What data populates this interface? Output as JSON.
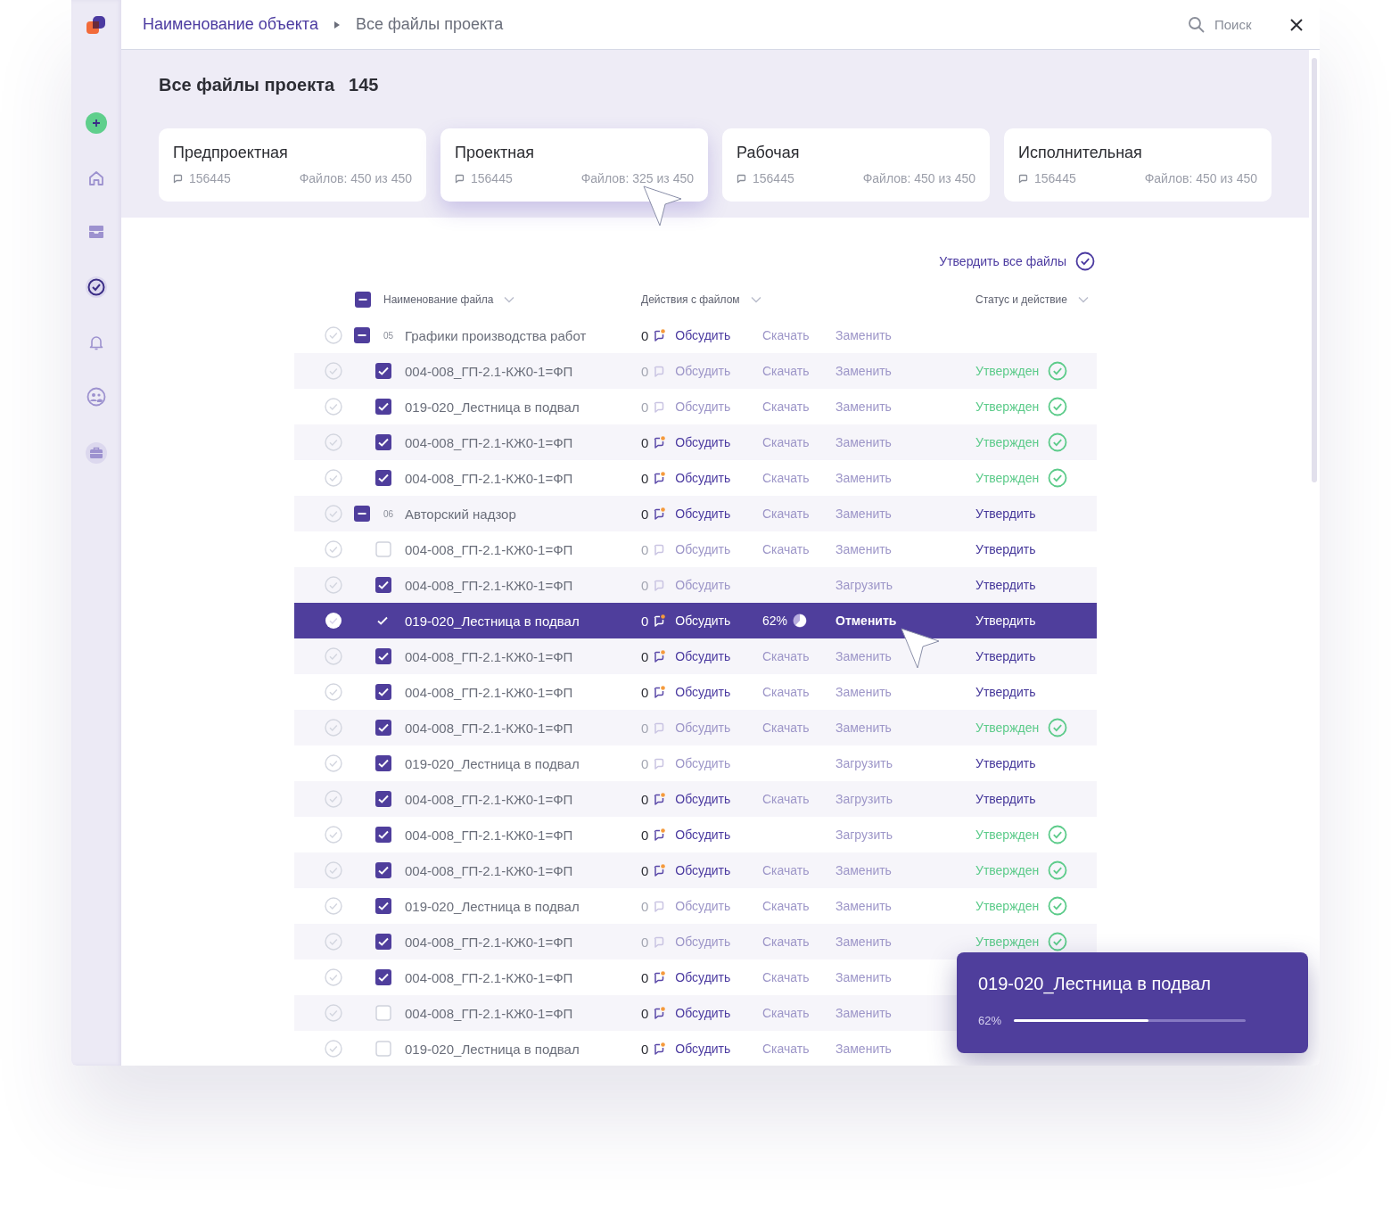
{
  "sidebar": {
    "items": [
      {
        "kind": "add",
        "selected": false
      },
      {
        "kind": "home",
        "selected": false
      },
      {
        "kind": "inbox",
        "selected": false
      },
      {
        "kind": "tasks",
        "selected": true
      },
      {
        "kind": "bell",
        "selected": false
      },
      {
        "kind": "people",
        "selected": false
      },
      {
        "kind": "briefcase",
        "selected": false
      }
    ]
  },
  "breadcrumb": [
    {
      "label": "Наименование объекта",
      "kind": "link"
    },
    {
      "label": "Все файлы проекта",
      "kind": "current"
    }
  ],
  "search": {
    "placeholder": "Поиск"
  },
  "page": {
    "title": "Все файлы проекта",
    "count": "145"
  },
  "stages": [
    {
      "title": "Предпроектная",
      "comments": "156445",
      "files": "Файлов: 450 из 450",
      "selected": false
    },
    {
      "title": "Проектная",
      "comments": "156445",
      "files": "Файлов: 325 из 450",
      "selected": true
    },
    {
      "title": "Рабочая",
      "comments": "156445",
      "files": "Файлов: 450 из 450",
      "selected": false
    },
    {
      "title": "Исполнительная",
      "comments": "156445",
      "files": "Файлов: 450 из 450",
      "selected": false
    }
  ],
  "approve_all": "Утвердить все файлы",
  "table": {
    "select_all": {
      "partial": true
    },
    "columns": [
      {
        "label": "Наименование файла"
      },
      {
        "label": "Действия с файлом"
      },
      {
        "label": "Статус и действие"
      }
    ],
    "groups": [
      {
        "number": "05",
        "name": "Графики производства работ",
        "partial": true,
        "comments": {
          "count": "0",
          "active": true
        },
        "discuss": "Обсудить",
        "download": {
          "kind": "link",
          "label": "Скачать"
        },
        "replace": "Заменить",
        "children": [
          {
            "name": "004-008_ГП-2.1-КЖ0-1=ФП",
            "checked": true,
            "selected": false,
            "comments": {
              "count": "0",
              "active": false
            },
            "discuss": "Обсудить",
            "download": {
              "kind": "link",
              "label": "Скачать"
            },
            "replace": "Заменить",
            "status": {
              "kind": "approved",
              "label": "Утвержден"
            }
          },
          {
            "name": "019-020_Лестница в подвал",
            "checked": true,
            "selected": false,
            "comments": {
              "count": "0",
              "active": false
            },
            "discuss": "Обсудить",
            "download": {
              "kind": "link",
              "label": "Скачать"
            },
            "replace": "Заменить",
            "status": {
              "kind": "approved",
              "label": "Утвержден"
            }
          },
          {
            "name": "004-008_ГП-2.1-КЖ0-1=ФП",
            "checked": true,
            "selected": false,
            "comments": {
              "count": "0",
              "active": true
            },
            "discuss": "Обсудить",
            "download": {
              "kind": "link",
              "label": "Скачать"
            },
            "replace": "Заменить",
            "status": {
              "kind": "approved",
              "label": "Утвержден"
            }
          },
          {
            "name": "004-008_ГП-2.1-КЖ0-1=ФП",
            "checked": true,
            "selected": false,
            "comments": {
              "count": "0",
              "active": true
            },
            "discuss": "Обсудить",
            "download": {
              "kind": "link",
              "label": "Скачать"
            },
            "replace": "Заменить",
            "status": {
              "kind": "approved",
              "label": "Утвержден"
            }
          }
        ]
      },
      {
        "number": "06",
        "name": "Авторский надзор",
        "partial": true,
        "comments": {
          "count": "0",
          "active": true
        },
        "discuss": "Обсудить",
        "download": {
          "kind": "link",
          "label": "Скачать"
        },
        "replace": "Заменить",
        "status": {
          "kind": "approve",
          "label": "Утвердить"
        },
        "children": [
          {
            "name": "004-008_ГП-2.1-КЖ0-1=ФП",
            "checked": false,
            "selected": false,
            "comments": {
              "count": "0",
              "active": false
            },
            "discuss": "Обсудить",
            "download": {
              "kind": "link",
              "label": "Скачать"
            },
            "replace": "Заменить",
            "status": {
              "kind": "approve",
              "label": "Утвердить"
            }
          },
          {
            "name": "004-008_ГП-2.1-КЖ0-1=ФП",
            "checked": true,
            "selected": false,
            "comments": {
              "count": "0",
              "active": false
            },
            "discuss": "Обсудить",
            "replace": "Загрузить",
            "status": {
              "kind": "approve",
              "label": "Утвердить"
            }
          },
          {
            "name": "019-020_Лестница в подвал",
            "checked": true,
            "selected": true,
            "comments": {
              "count": "0",
              "active": true
            },
            "discuss": "Обсудить",
            "download": {
              "kind": "progress",
              "label": "62%",
              "level": 0.62
            },
            "replace": "Отменить",
            "status": {
              "kind": "approve",
              "label": "Утвердить"
            }
          },
          {
            "name": "004-008_ГП-2.1-КЖ0-1=ФП",
            "checked": true,
            "selected": false,
            "comments": {
              "count": "0",
              "active": true
            },
            "discuss": "Обсудить",
            "download": {
              "kind": "link",
              "label": "Скачать"
            },
            "replace": "Заменить",
            "status": {
              "kind": "approve",
              "label": "Утвердить"
            }
          },
          {
            "name": "004-008_ГП-2.1-КЖ0-1=ФП",
            "checked": true,
            "selected": false,
            "comments": {
              "count": "0",
              "active": true
            },
            "discuss": "Обсудить",
            "download": {
              "kind": "link",
              "label": "Скачать"
            },
            "replace": "Заменить",
            "status": {
              "kind": "approve",
              "label": "Утвердить"
            }
          },
          {
            "name": "004-008_ГП-2.1-КЖ0-1=ФП",
            "checked": true,
            "selected": false,
            "comments": {
              "count": "0",
              "active": false
            },
            "discuss": "Обсудить",
            "download": {
              "kind": "link",
              "label": "Скачать"
            },
            "replace": "Заменить",
            "status": {
              "kind": "approved",
              "label": "Утвержден"
            }
          },
          {
            "name": "019-020_Лестница в подвал",
            "checked": true,
            "selected": false,
            "comments": {
              "count": "0",
              "active": false
            },
            "discuss": "Обсудить",
            "replace": "Загрузить",
            "status": {
              "kind": "approve",
              "label": "Утвердить"
            }
          },
          {
            "name": "004-008_ГП-2.1-КЖ0-1=ФП",
            "checked": true,
            "selected": false,
            "comments": {
              "count": "0",
              "active": true
            },
            "discuss": "Обсудить",
            "download": {
              "kind": "link",
              "label": "Скачать"
            },
            "replace": "Загрузить",
            "status": {
              "kind": "approve",
              "label": "Утвердить"
            }
          },
          {
            "name": "004-008_ГП-2.1-КЖ0-1=ФП",
            "checked": true,
            "selected": false,
            "comments": {
              "count": "0",
              "active": true
            },
            "discuss": "Обсудить",
            "replace": "Загрузить",
            "status": {
              "kind": "approved",
              "label": "Утвержден"
            }
          },
          {
            "name": "004-008_ГП-2.1-КЖ0-1=ФП",
            "checked": true,
            "selected": false,
            "comments": {
              "count": "0",
              "active": true
            },
            "discuss": "Обсудить",
            "download": {
              "kind": "link",
              "label": "Скачать"
            },
            "replace": "Заменить",
            "status": {
              "kind": "approved",
              "label": "Утвержден"
            }
          },
          {
            "name": "019-020_Лестница в подвал",
            "checked": true,
            "selected": false,
            "comments": {
              "count": "0",
              "active": false
            },
            "discuss": "Обсудить",
            "download": {
              "kind": "link",
              "label": "Скачать"
            },
            "replace": "Заменить",
            "status": {
              "kind": "approved",
              "label": "Утвержден"
            }
          },
          {
            "name": "004-008_ГП-2.1-КЖ0-1=ФП",
            "checked": true,
            "selected": false,
            "comments": {
              "count": "0",
              "active": false
            },
            "discuss": "Обсудить",
            "download": {
              "kind": "link",
              "label": "Скачать"
            },
            "replace": "Заменить",
            "status": {
              "kind": "approved",
              "label": "Утвержден"
            }
          },
          {
            "name": "004-008_ГП-2.1-КЖ0-1=ФП",
            "checked": true,
            "selected": false,
            "comments": {
              "count": "0",
              "active": true
            },
            "discuss": "Обсудить",
            "download": {
              "kind": "link",
              "label": "Скачать"
            },
            "replace": "Заменить"
          },
          {
            "name": "004-008_ГП-2.1-КЖ0-1=ФП",
            "checked": false,
            "selected": false,
            "comments": {
              "count": "0",
              "active": true
            },
            "discuss": "Обсудить",
            "download": {
              "kind": "link",
              "label": "Скачать"
            },
            "replace": "Заменить"
          },
          {
            "name": "019-020_Лестница в подвал",
            "checked": false,
            "selected": false,
            "comments": {
              "count": "0",
              "active": true
            },
            "discuss": "Обсудить",
            "download": {
              "kind": "link",
              "label": "Скачать"
            },
            "replace": "Заменить"
          }
        ]
      }
    ]
  },
  "upload_toast": {
    "title": "019-020_Лестница в подвал",
    "percent": "62%",
    "level": 0.58
  }
}
